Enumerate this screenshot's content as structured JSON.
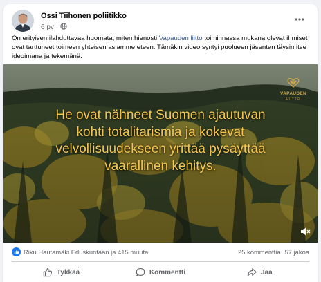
{
  "post": {
    "author": "Ossi Tiihonen poliitikko",
    "time": "6 pv",
    "separator": "·",
    "privacy_icon": "globe-icon",
    "text_before_link": "On erityisen ilahduttavaa huomata, miten hienosti ",
    "link_text": "Vapauden liitto",
    "text_after_link": " toiminnassa mukana olevat ihmiset ovat tarttuneet toimeen yhteisen asiamme eteen. Tämäkin video syntyi puolueen jäsenten täysin itse ideoimana ja tekemänä."
  },
  "video": {
    "caption_lines": [
      "He ovat nähneet Suomen ajautuvan",
      "kohti totalitarismia ja kokevat",
      "velvollisuudekseen yrittää pysäyttää",
      "vaarallinen kehitys."
    ],
    "brand_name": "VAPAUDEN",
    "brand_sub": "LIITTO",
    "colors": {
      "caption": "#f4c54f",
      "brand": "#c9a64d"
    }
  },
  "stats": {
    "reactions_text": "Riku Hautamäki Eduskuntaan ja 415 muuta",
    "comments": "25 kommenttia",
    "shares": "57 jakoa"
  },
  "actions": {
    "like": "Tykkää",
    "comment": "Kommentti",
    "share": "Jaa"
  },
  "colors": {
    "link": "#385898",
    "accent": "#1877f2",
    "muted": "#65676b"
  }
}
